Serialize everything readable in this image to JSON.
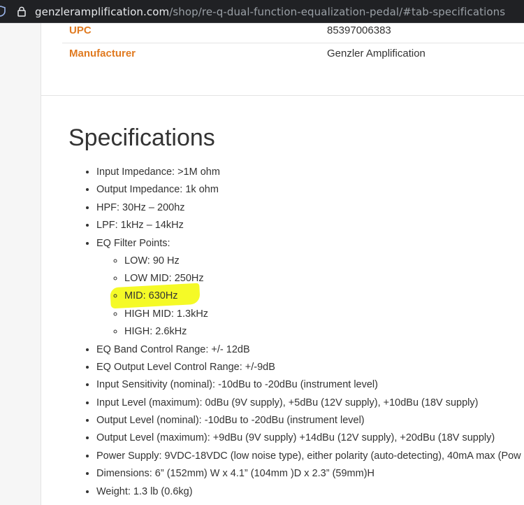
{
  "browser": {
    "url_host": "genzleramplification.com",
    "url_path": "/shop/re-q-dual-function-equalization-pedal/#tab-specifications"
  },
  "info_rows": [
    {
      "label": "UPC",
      "value": "85397006383"
    },
    {
      "label": "Manufacturer",
      "value": "Genzler Amplification"
    }
  ],
  "specs": {
    "title": "Specifications",
    "items": [
      "Input Impedance: >1M ohm",
      "Output Impedance: 1k ohm",
      "HPF: 30Hz – 200hz",
      "LPF: 1kHz – 14kHz",
      "EQ Filter Points:"
    ],
    "sub_items": [
      "LOW: 90 Hz",
      "LOW MID: 250Hz",
      "MID: 630Hz",
      "HIGH MID: 1.3kHz",
      "HIGH: 2.6kHz"
    ],
    "items_after": [
      "EQ Band Control Range:  +/- 12dB",
      "EQ Output Level Control Range:  +/-9dB",
      "Input Sensitivity (nominal):  -10dBu to -20dBu (instrument level)",
      "Input Level (maximum): 0dBu (9V supply), +5dBu (12V supply), +10dBu (18V supply)",
      "Output Level (nominal): -10dBu to -20dBu (instrument level)",
      "Output Level (maximum): +9dBu (9V supply) +14dBu (12V supply), +20dBu (18V supply)",
      "Power Supply: 9VDC-18VDC (low noise type), either polarity (auto-detecting), 40mA max   (Pow",
      "Dimensions: 6” (152mm) W x 4.1” (104mm )D x 2.3” (59mm)H",
      "Weight: 1.3 lb (0.6kg)"
    ]
  },
  "highlight_color": "#f4f90f"
}
